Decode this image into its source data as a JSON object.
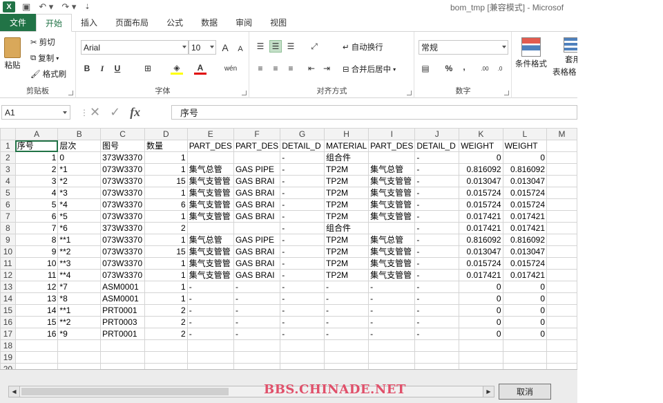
{
  "app": {
    "logo": "X",
    "title": "bom_tmp  [兼容模式] - Microsof"
  },
  "tabs": [
    "文件",
    "开始",
    "插入",
    "页面布局",
    "公式",
    "数据",
    "审阅",
    "视图"
  ],
  "ribbon": {
    "clipboard": {
      "paste": "粘贴",
      "cut": "剪切",
      "copy": "复制",
      "format_painter": "格式刷",
      "label": "剪贴板"
    },
    "font": {
      "name": "Arial",
      "size": "10",
      "bold": "B",
      "italic": "I",
      "underline": "U",
      "label": "字体",
      "grow": "A",
      "shrink": "A"
    },
    "alignment": {
      "wrap": "自动换行",
      "merge": "合并后居中",
      "label": "对齐方式"
    },
    "number": {
      "format": "常规",
      "percent": "%",
      "comma": ",",
      "label": "数字"
    },
    "styles": {
      "conditional": "条件格式",
      "table_a": "套用",
      "table_b": "表格格"
    }
  },
  "formula_bar": {
    "name_box": "A1",
    "fx": "fx",
    "value": "序号"
  },
  "columns": [
    "A",
    "B",
    "C",
    "D",
    "E",
    "F",
    "G",
    "H",
    "I",
    "J",
    "K",
    "L",
    "M"
  ],
  "rows": [
    [
      "序号",
      "层次",
      "图号",
      "数量",
      "PART_DES",
      "PART_DES",
      "DETAIL_D",
      "MATERIAL",
      "PART_DES",
      "DETAIL_D",
      "WEIGHT",
      "WEIGHT",
      ""
    ],
    [
      "1",
      "0",
      "373W3370",
      "1",
      "",
      "",
      "-",
      "组合件",
      "",
      "-",
      "0",
      "0",
      ""
    ],
    [
      "2",
      "*1",
      "073W3370",
      "1",
      "集气总管",
      "GAS PIPE",
      "-",
      "TP2M",
      "集气总管",
      "-",
      "0.816092",
      "0.816092",
      ""
    ],
    [
      "3",
      "*2",
      "073W3370",
      "15",
      "集气支管管",
      "GAS BRAI",
      "-",
      "TP2M",
      "集气支管管",
      "-",
      "0.013047",
      "0.013047",
      ""
    ],
    [
      "4",
      "*3",
      "073W3370",
      "1",
      "集气支管管",
      "GAS BRAI",
      "-",
      "TP2M",
      "集气支管管",
      "-",
      "0.015724",
      "0.015724",
      ""
    ],
    [
      "5",
      "*4",
      "073W3370",
      "6",
      "集气支管管",
      "GAS BRAI",
      "-",
      "TP2M",
      "集气支管管",
      "-",
      "0.015724",
      "0.015724",
      ""
    ],
    [
      "6",
      "*5",
      "073W3370",
      "1",
      "集气支管管",
      "GAS BRAI",
      "-",
      "TP2M",
      "集气支管管",
      "-",
      "0.017421",
      "0.017421",
      ""
    ],
    [
      "7",
      "*6",
      "373W3370",
      "2",
      "",
      "",
      "-",
      "组合件",
      "",
      "-",
      "0.017421",
      "0.017421",
      ""
    ],
    [
      "8",
      "**1",
      "073W3370",
      "1",
      "集气总管",
      "GAS PIPE",
      "-",
      "TP2M",
      "集气总管",
      "-",
      "0.816092",
      "0.816092",
      ""
    ],
    [
      "9",
      "**2",
      "073W3370",
      "15",
      "集气支管管",
      "GAS BRAI",
      "-",
      "TP2M",
      "集气支管管",
      "-",
      "0.013047",
      "0.013047",
      ""
    ],
    [
      "10",
      "**3",
      "073W3370",
      "1",
      "集气支管管",
      "GAS BRAI",
      "-",
      "TP2M",
      "集气支管管",
      "-",
      "0.015724",
      "0.015724",
      ""
    ],
    [
      "11",
      "**4",
      "073W3370",
      "1",
      "集气支管管",
      "GAS BRAI",
      "-",
      "TP2M",
      "集气支管管",
      "-",
      "0.017421",
      "0.017421",
      ""
    ],
    [
      "12",
      "*7",
      "ASM0001",
      "1",
      "-",
      "-",
      "-",
      "-",
      "-",
      "-",
      "0",
      "0",
      ""
    ],
    [
      "13",
      "*8",
      "ASM0001",
      "1",
      "-",
      "-",
      "-",
      "-",
      "-",
      "-",
      "0",
      "0",
      ""
    ],
    [
      "14",
      "**1",
      "PRT0001",
      "2",
      "-",
      "-",
      "-",
      "-",
      "-",
      "-",
      "0",
      "0",
      ""
    ],
    [
      "15",
      "**2",
      "PRT0003",
      "2",
      "-",
      "-",
      "-",
      "-",
      "-",
      "-",
      "0",
      "0",
      ""
    ],
    [
      "16",
      "*9",
      "PRT0001",
      "2",
      "-",
      "-",
      "-",
      "-",
      "-",
      "-",
      "0",
      "0",
      ""
    ],
    [
      "",
      "",
      "",
      "",
      "",
      "",
      "",
      "",
      "",
      "",
      "",
      "",
      ""
    ],
    [
      "",
      "",
      "",
      "",
      "",
      "",
      "",
      "",
      "",
      "",
      "",
      "",
      ""
    ],
    [
      "",
      "",
      "",
      "",
      "",
      "",
      "",
      "",
      "",
      "",
      "",
      "",
      ""
    ]
  ],
  "numeric_cols": [
    0,
    3,
    10,
    11
  ],
  "dialog": {
    "cancel": "取消"
  },
  "watermark": "BBS.CHINADE.NET",
  "colors": {
    "accent": "#217346",
    "watermark": "#e0506a"
  }
}
